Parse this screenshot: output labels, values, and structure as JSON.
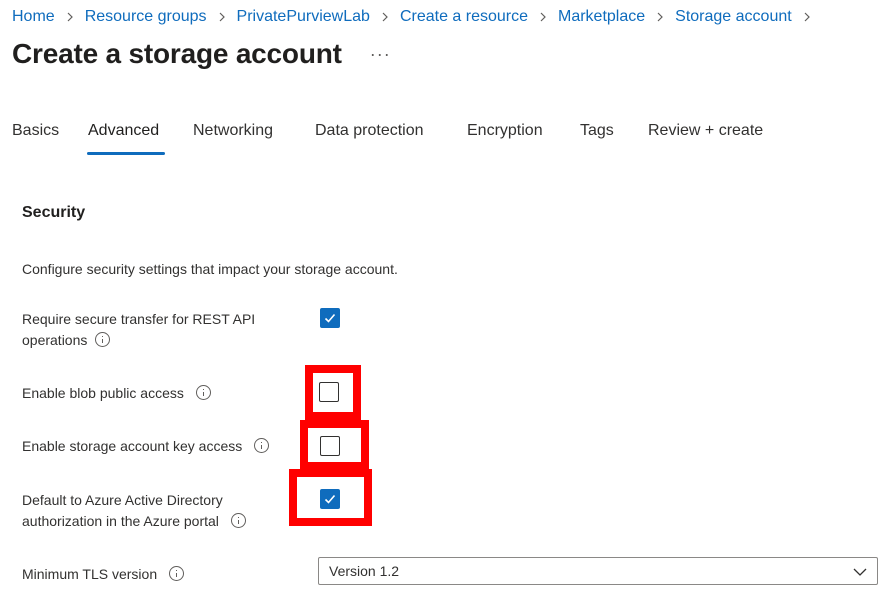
{
  "breadcrumb": {
    "items": [
      "Home",
      "Resource groups",
      "PrivatePurviewLab",
      "Create a resource",
      "Marketplace",
      "Storage account"
    ]
  },
  "page": {
    "title": "Create a storage account",
    "more_label": "···"
  },
  "tabs": [
    {
      "label": "Basics",
      "active": false
    },
    {
      "label": "Advanced",
      "active": true
    },
    {
      "label": "Networking",
      "active": false
    },
    {
      "label": "Data protection",
      "active": false
    },
    {
      "label": "Encryption",
      "active": false
    },
    {
      "label": "Tags",
      "active": false
    },
    {
      "label": "Review + create",
      "active": false
    }
  ],
  "security": {
    "title": "Security",
    "description": "Configure security settings that impact your storage account.",
    "settings": [
      {
        "label_line1": "Require secure transfer for REST API",
        "label_line2": "operations",
        "checked": true
      },
      {
        "label": "Enable blob public access",
        "checked": false
      },
      {
        "label": "Enable storage account key access",
        "checked": false
      },
      {
        "label_line1": "Default to Azure Active Directory",
        "label_line2": "authorization in the Azure portal",
        "checked": true
      }
    ],
    "tls": {
      "label": "Minimum TLS version",
      "value": "Version 1.2"
    }
  },
  "colors": {
    "accent": "#0f6cbd",
    "highlight": "#ff0000"
  }
}
